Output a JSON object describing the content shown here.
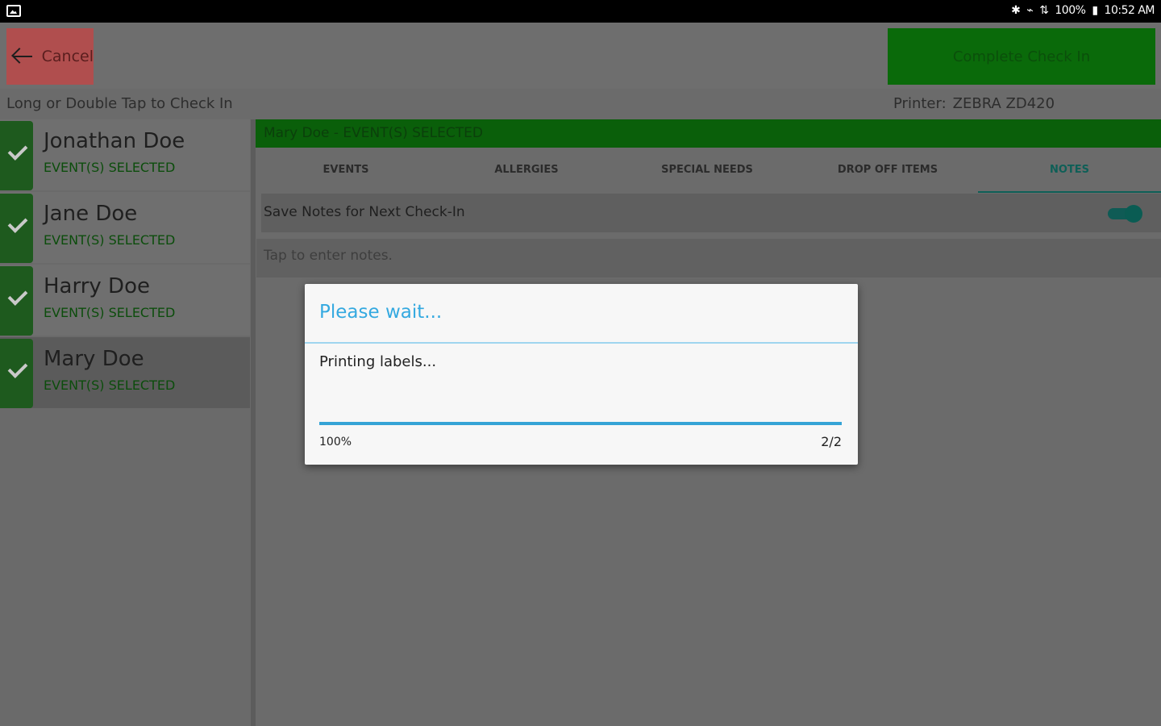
{
  "status_bar": {
    "right_text": [
      "✱",
      "⌁",
      "⇅",
      "100%",
      "▮",
      "10:52 AM"
    ]
  },
  "toolbar": {
    "cancel_label": "Cancel",
    "complete_label": "Complete Check In",
    "instructions": "Long or Double Tap to Check In",
    "printer_label": "Printer:",
    "printer_value": "ZEBRA ZD420"
  },
  "people": [
    {
      "name": "Jonathan Doe",
      "status": "EVENT(S) SELECTED",
      "checked": true
    },
    {
      "name": "Jane Doe",
      "status": "EVENT(S) SELECTED",
      "checked": true
    },
    {
      "name": "Harry Doe",
      "status": "EVENT(S) SELECTED",
      "checked": true
    },
    {
      "name": "Mary Doe",
      "status": "EVENT(S) SELECTED",
      "checked": true,
      "selected": true
    }
  ],
  "detail": {
    "header": "Mary Doe - EVENT(S) SELECTED",
    "tabs": [
      {
        "label": "EVENTS"
      },
      {
        "label": "ALLERGIES"
      },
      {
        "label": "SPECIAL NEEDS"
      },
      {
        "label": "DROP OFF ITEMS"
      },
      {
        "label": "NOTES",
        "active": true
      }
    ],
    "save_notes_label": "Save Notes for Next Check-In",
    "save_notes_enabled": true,
    "notes_placeholder": "Tap to enter notes."
  },
  "dialog": {
    "title": "Please wait...",
    "message": "Printing labels...",
    "progress_fraction": 1.0,
    "progress_percent_text": "100%",
    "progress_count_text": "2/2"
  },
  "colors": {
    "cancel": "#b04e4e",
    "complete": "#0a6a0a",
    "accent": "#34a9e0",
    "toggle": "#0f5b55"
  }
}
